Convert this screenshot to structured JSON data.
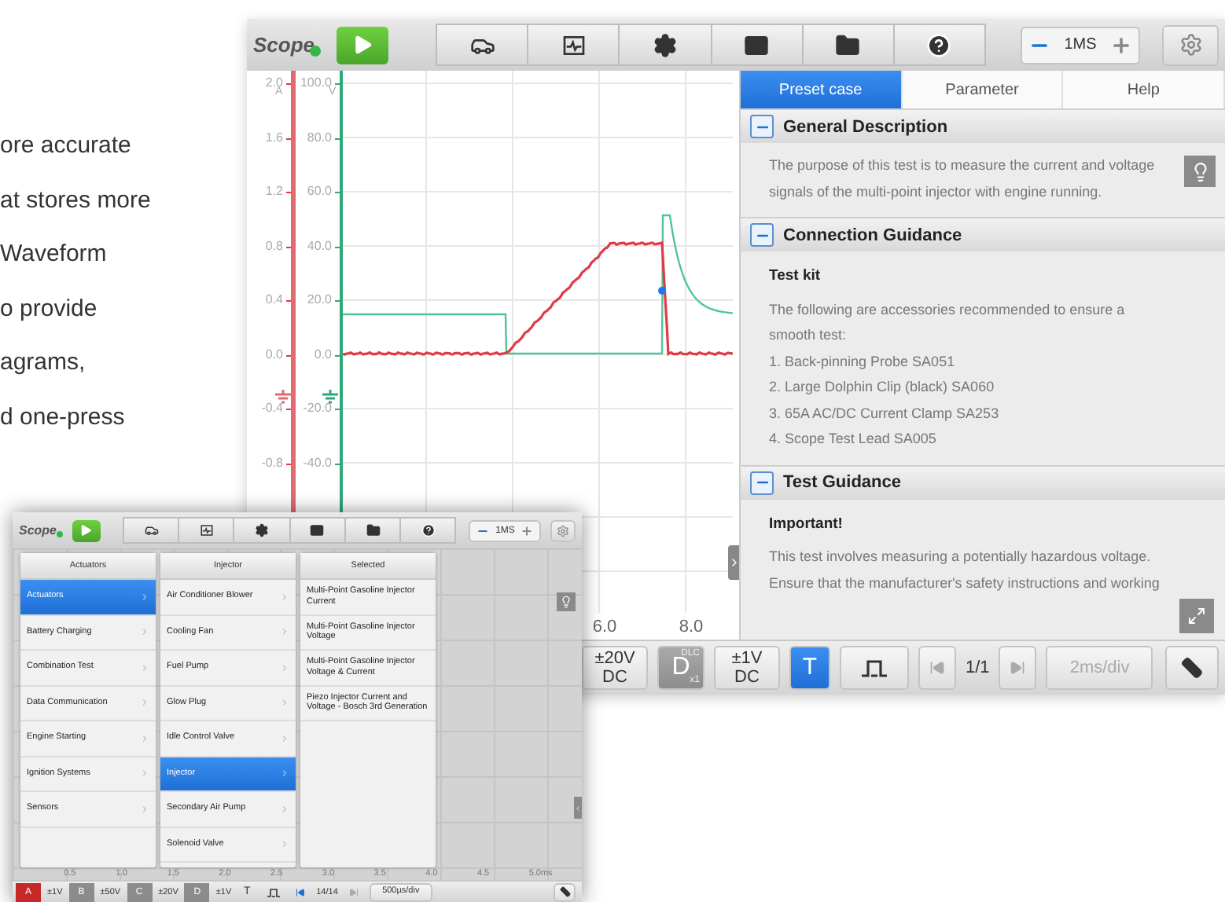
{
  "copy_lines": [
    "ore accurate",
    "at stores more",
    "Waveform",
    "o provide",
    "agrams,",
    "d one-press"
  ],
  "main_screen": {
    "toolbar": {
      "app_name": "Scope",
      "connected": true,
      "time_base": "1MS"
    },
    "chart": {
      "current_ticks": [
        "2.0",
        "1.6",
        "1.2",
        "0.8",
        "0.4",
        "0.0",
        "-0.4",
        "-0.8"
      ],
      "current_unit": "A",
      "voltage_ticks": [
        "100.0",
        "80.0",
        "60.0",
        "40.0",
        "20.0",
        "0.0",
        "-20.0",
        "-40.0"
      ],
      "voltage_unit": "V",
      "time_labels": [
        "6.0",
        "8.0"
      ]
    },
    "panel": {
      "tabs": [
        {
          "label": "Preset case",
          "selected": true
        },
        {
          "label": "Parameter",
          "selected": false
        },
        {
          "label": "Help",
          "selected": false
        }
      ],
      "sections": [
        {
          "title": "General Description",
          "expanded": true,
          "blocks": [
            {
              "kind": "text",
              "text": "The purpose of this test is to measure the current and voltage signals of the multi-point injector with engine running."
            }
          ]
        },
        {
          "title": "Connection Guidance",
          "expanded": true,
          "blocks": [
            {
              "kind": "heading",
              "text": "Test kit"
            },
            {
              "kind": "text",
              "text": "The following are accessories recommended to ensure a smooth test:"
            },
            {
              "kind": "text",
              "text": "1. Back-pinning Probe SA051"
            },
            {
              "kind": "text",
              "text": "2. Large Dolphin Clip (black) SA060"
            },
            {
              "kind": "text",
              "text": "3. 65A AC/DC Current Clamp SA253"
            },
            {
              "kind": "text",
              "text": "4. Scope Test Lead SA005"
            }
          ]
        },
        {
          "title": "Test Guidance",
          "expanded": true,
          "blocks": [
            {
              "kind": "heading",
              "text": "Important!"
            },
            {
              "kind": "text",
              "text": "This test involves measuring a potentially hazardous voltage. Ensure that the manufacturer's safety instructions and working"
            }
          ]
        }
      ]
    },
    "bottom_bar": [
      {
        "kind": "range",
        "value": "±20V",
        "coupling": "DC"
      },
      {
        "kind": "channel",
        "letter": "D",
        "tag": "DLC",
        "probe": "x1"
      },
      {
        "kind": "range",
        "value": "±1V",
        "coupling": "DC"
      },
      {
        "kind": "toggle",
        "label": "T",
        "selected": true
      },
      {
        "kind": "pulse"
      },
      {
        "kind": "prev",
        "disabled": true
      },
      {
        "kind": "page",
        "label": "1/1"
      },
      {
        "kind": "next",
        "disabled": true
      },
      {
        "kind": "timebase",
        "label": "2ms/div",
        "disabled": true
      },
      {
        "kind": "ruler"
      }
    ]
  },
  "small_screen": {
    "toolbar": {
      "app_name": "Scope",
      "connected": true,
      "time_base": "1MS"
    },
    "columns": [
      {
        "header": "Actuators",
        "items": [
          {
            "label": "Actuators",
            "selected": true
          },
          {
            "label": "Battery Charging",
            "selected": false
          },
          {
            "label": "Combination Test",
            "selected": false
          },
          {
            "label": "Data Communication",
            "selected": false
          },
          {
            "label": "Engine Starting",
            "selected": false
          },
          {
            "label": "Ignition Systems",
            "selected": false
          },
          {
            "label": "Sensors",
            "selected": false
          }
        ]
      },
      {
        "header": "Injector",
        "items": [
          {
            "label": "Air Conditioner Blower",
            "selected": false
          },
          {
            "label": "Cooling Fan",
            "selected": false
          },
          {
            "label": "Fuel Pump",
            "selected": false
          },
          {
            "label": "Glow Plug",
            "selected": false
          },
          {
            "label": "Idle Control Valve",
            "selected": false
          },
          {
            "label": "Injector",
            "selected": true
          },
          {
            "label": "Secondary Air Pump",
            "selected": false
          },
          {
            "label": "Solenoid Valve",
            "selected": false
          }
        ]
      },
      {
        "header": "Selected",
        "items": [
          {
            "label": "Multi-Point Gasoline Injector Current",
            "selected": false
          },
          {
            "label": "Multi-Point Gasoline Injector Voltage",
            "selected": false
          },
          {
            "label": "Multi-Point Gasoline Injector Voltage & Current",
            "selected": false
          },
          {
            "label": "Piezo Injector Current and Voltage - Bosch 3rd Generation",
            "selected": false
          }
        ]
      }
    ],
    "time_labels": [
      "0.5",
      "1.0",
      "1.5",
      "2.0",
      "2.5",
      "3.0",
      "3.5",
      "4.0",
      "4.5",
      "5.0ms"
    ],
    "bottom_bar": [
      {
        "kind": "channel",
        "letter": "A",
        "color": "#c62828",
        "range": "±1V"
      },
      {
        "kind": "channel",
        "letter": "B",
        "color": "#8c8c8c",
        "range": "±50V"
      },
      {
        "kind": "channel",
        "letter": "C",
        "color": "#8c8c8c",
        "range": "±20V"
      },
      {
        "kind": "channel",
        "letter": "D",
        "color": "#8c8c8c",
        "range": "±1V"
      },
      {
        "kind": "toggle",
        "label": "T",
        "selected": false
      },
      {
        "kind": "pulse"
      },
      {
        "kind": "prev",
        "disabled": false
      },
      {
        "kind": "page",
        "label": "14/14"
      },
      {
        "kind": "next",
        "disabled": true
      },
      {
        "kind": "timebase",
        "label": "500µs/div",
        "disabled": false
      },
      {
        "kind": "ruler"
      }
    ]
  }
}
